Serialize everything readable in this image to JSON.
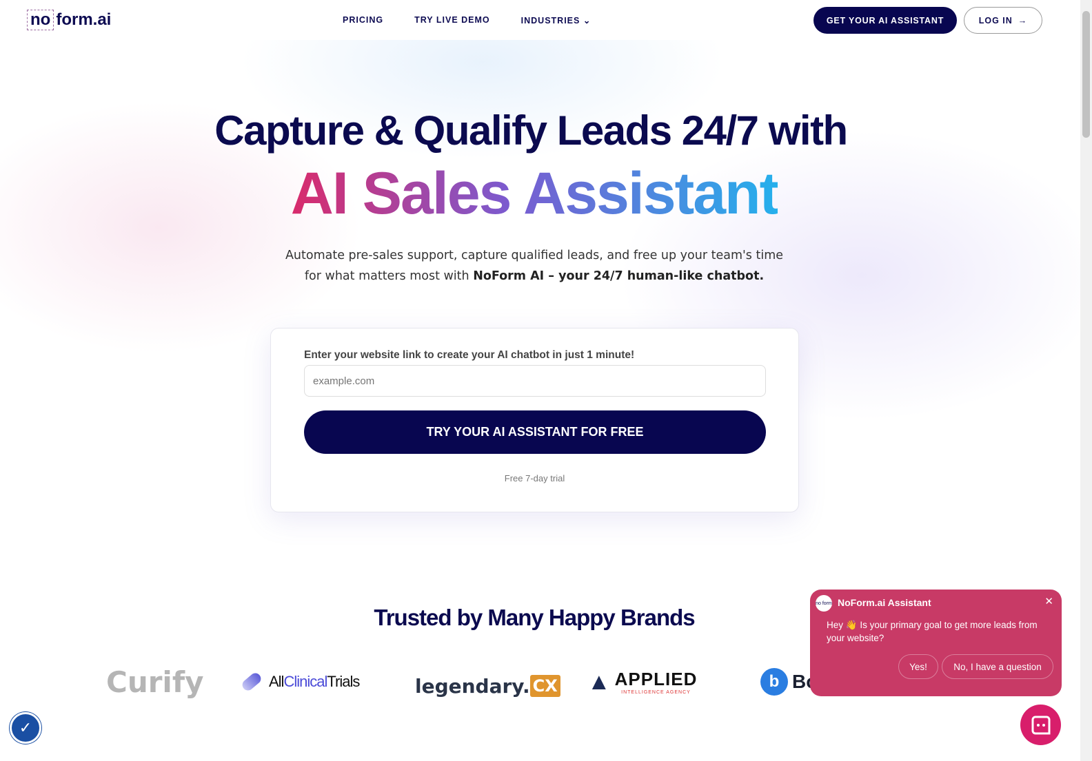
{
  "nav": {
    "logo_no": "no",
    "logo_rest": "form.ai",
    "links": [
      "PRICING",
      "TRY LIVE DEMO",
      "INDUSTRIES"
    ],
    "cta": "GET YOUR AI ASSISTANT",
    "login": "LOG IN"
  },
  "hero": {
    "line1": "Capture & Qualify Leads 24/7 with",
    "line2": "AI Sales Assistant",
    "sub1": "Automate pre-sales support, capture qualified leads, and free up your team's time",
    "sub2": "for what matters most with ",
    "sub2_bold": "NoForm AI – your 24/7 human-like chatbot."
  },
  "form": {
    "label": "Enter your website link to create your AI chatbot in just 1 minute!",
    "placeholder": "example.com",
    "button": "TRY YOUR AI ASSISTANT FOR FREE",
    "note": "Free 7-day trial"
  },
  "trusted": {
    "title": "Trusted by Many Happy Brands",
    "brands": [
      "Curify",
      "All",
      "Clinical",
      "Trials",
      "legendary.",
      "CX",
      "APPLIED",
      "INTELLIGENCE AGENCY",
      "Bo"
    ]
  },
  "chat": {
    "avatar": "no form",
    "title": "NoForm.ai Assistant",
    "message": "Hey 👋 Is your primary goal to get more leads from your website?",
    "yes": "Yes!",
    "no": "No, I have a question"
  },
  "colors": {
    "navy": "#080650",
    "chat": "#c83a66",
    "fab": "#d81e6b"
  }
}
